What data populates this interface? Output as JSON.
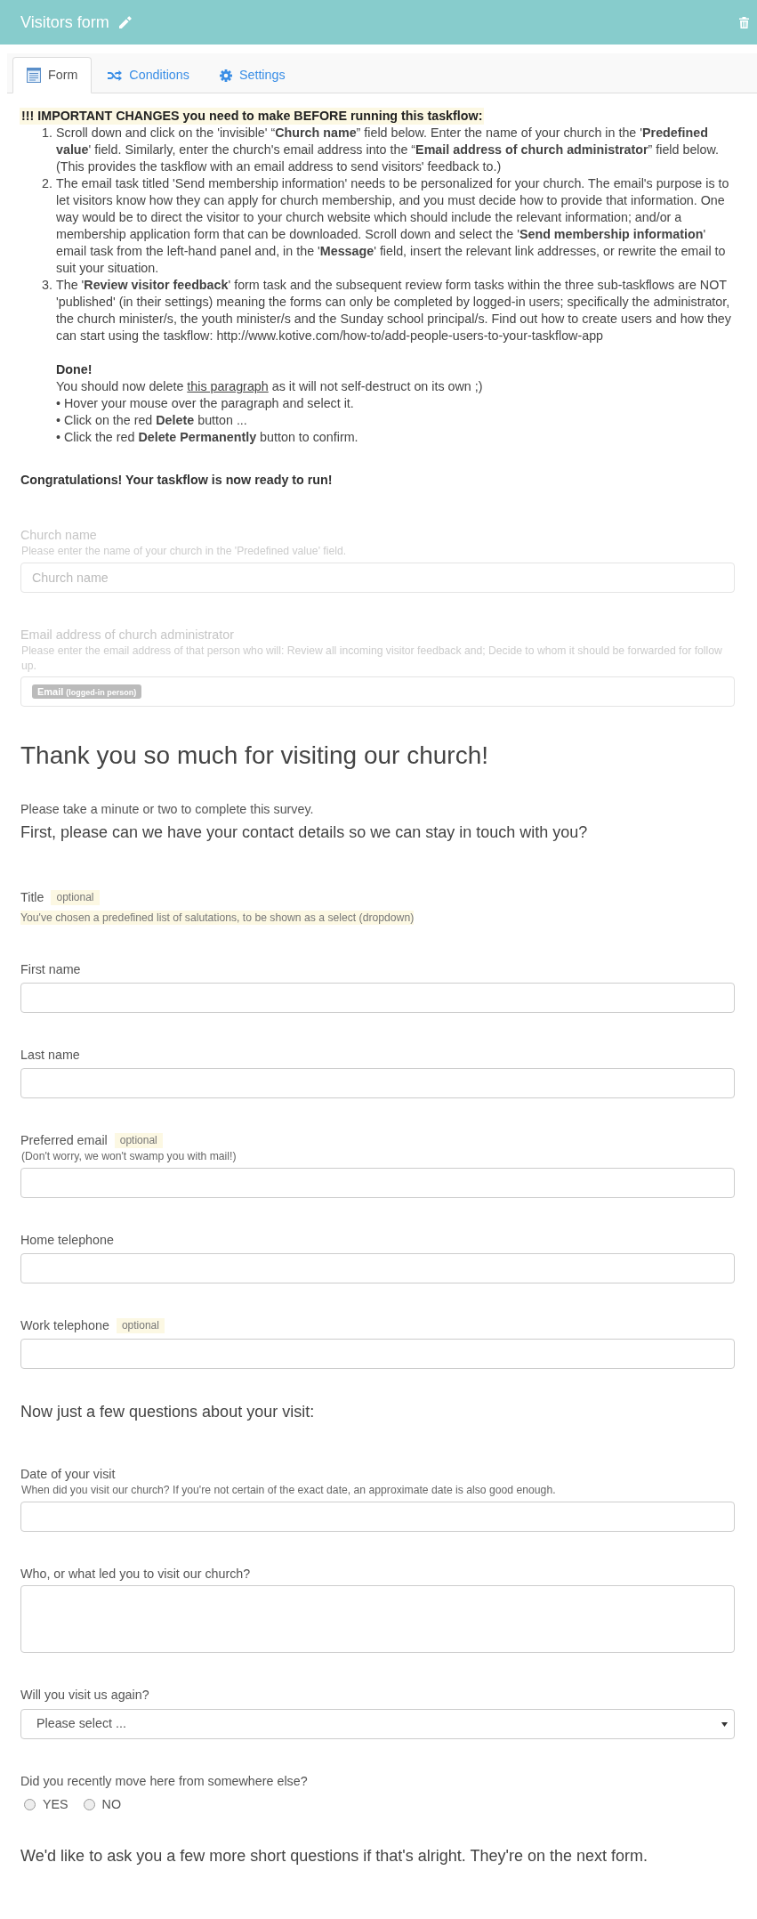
{
  "header": {
    "title": "Visitors form"
  },
  "tabs": [
    {
      "label": "Form",
      "selected": true
    },
    {
      "label": "Conditions",
      "selected": false
    },
    {
      "label": "Settings",
      "selected": false
    }
  ],
  "notice": {
    "heading": "!!! IMPORTANT CHANGES you need to make BEFORE running this taskflow:",
    "steps": [
      {
        "number": "1.",
        "text": "Scroll down and click on the 'invisible' “**Church name**” field below. Enter the name of your church in the '**Predefined value**' field. Similarly, enter the church's email address into the “**Email address of church administrator**” field below. (This provides the taskflow with an email address to send visitors' feedback to.)"
      },
      {
        "number": "2.",
        "text": "The email task titled 'Send membership information' needs to be personalized for your church. The email's purpose is to let visitors know how they can apply for church membership, and you must decide how to provide that information. One way would be to direct the visitor to your church website which should include the relevant information; and/or a membership application form that can be downloaded. Scroll down and select the '**Send membership information**' email task from the left-hand panel and, in the '**Message**' field, insert the relevant link addresses, or rewrite the email to suit your situation."
      },
      {
        "number": "3.",
        "text": "The '**Review visitor feedback**' form task and the subsequent review form tasks within the three sub-taskflows are NOT 'published' (in their settings) meaning the forms can only be completed by logged-in users; specifically the administrator, the church minister/s, the youth minister/s and the Sunday school principal/s. Find out how to create users and how they can start using the taskflow: http://www.kotive.com/how-to/add-people-users-to-your-taskflow-app"
      }
    ],
    "done": {
      "heading": "Done!",
      "text_before": "You should now delete",
      "link": "this paragraph",
      "text_after": "as it will not self-destruct on its own ;)",
      "bullets": [
        "• Hover your mouse over the paragraph and select it.",
        "• Click on the red **Delete** button ...",
        "• Click the red **Delete Permanently** button to confirm."
      ]
    }
  },
  "congratulations": "Congratulations! Your taskflow is now ready to run!",
  "setup_fields": [
    {
      "kind": "text",
      "label": "Church name",
      "help": "Please enter the name of your church in the 'Predefined value' field.",
      "placeholder": "Church name",
      "invisible": true
    },
    {
      "kind": "token",
      "label": "Email address of church administrator",
      "help": "Please enter the email address of that person who will: Review all incoming visitor feedback and; Decide to whom it should be forwarded for follow up.",
      "token": "Email",
      "token_note": "(logged-in person)",
      "invisible": true
    }
  ],
  "survey": {
    "title": "Thank you so much for visiting our church!",
    "intro": "Please take a minute or two to complete this survey.",
    "sections": [
      {
        "heading": "First, please can we have your contact details so we can stay in touch with you?",
        "fields": [
          {
            "kind": "note",
            "label": "Title",
            "badge": "optional",
            "note": "You've chosen a predefined list of salutations, to be shown as a select (dropdown)"
          },
          {
            "kind": "text",
            "label": "First name"
          },
          {
            "kind": "text",
            "label": "Last name"
          },
          {
            "kind": "text",
            "label": "Preferred email",
            "badge": "optional",
            "help": "(Don't worry, we won't swamp you with mail!)"
          },
          {
            "kind": "text",
            "label": "Home telephone"
          },
          {
            "kind": "text",
            "label": "Work telephone",
            "badge": "optional"
          }
        ]
      },
      {
        "heading": "Now just a few questions about your visit:",
        "fields": [
          {
            "kind": "text",
            "label": "Date of your visit",
            "help": "When did you visit our church? If you're not certain of the exact date, an approximate date is also good enough."
          },
          {
            "kind": "textarea",
            "label": "Who, or what led you to visit our church?"
          },
          {
            "kind": "select",
            "label": "Will you visit us again?",
            "value": "Please select ..."
          },
          {
            "kind": "radio",
            "label": "Did you recently move here from somewhere else?",
            "options": [
              {
                "label": "YES",
                "selected": false
              },
              {
                "label": "NO",
                "selected": false
              }
            ]
          }
        ]
      }
    ],
    "closing": "We'd like to ask you a few more short questions if that's alright. They're on the next form."
  }
}
